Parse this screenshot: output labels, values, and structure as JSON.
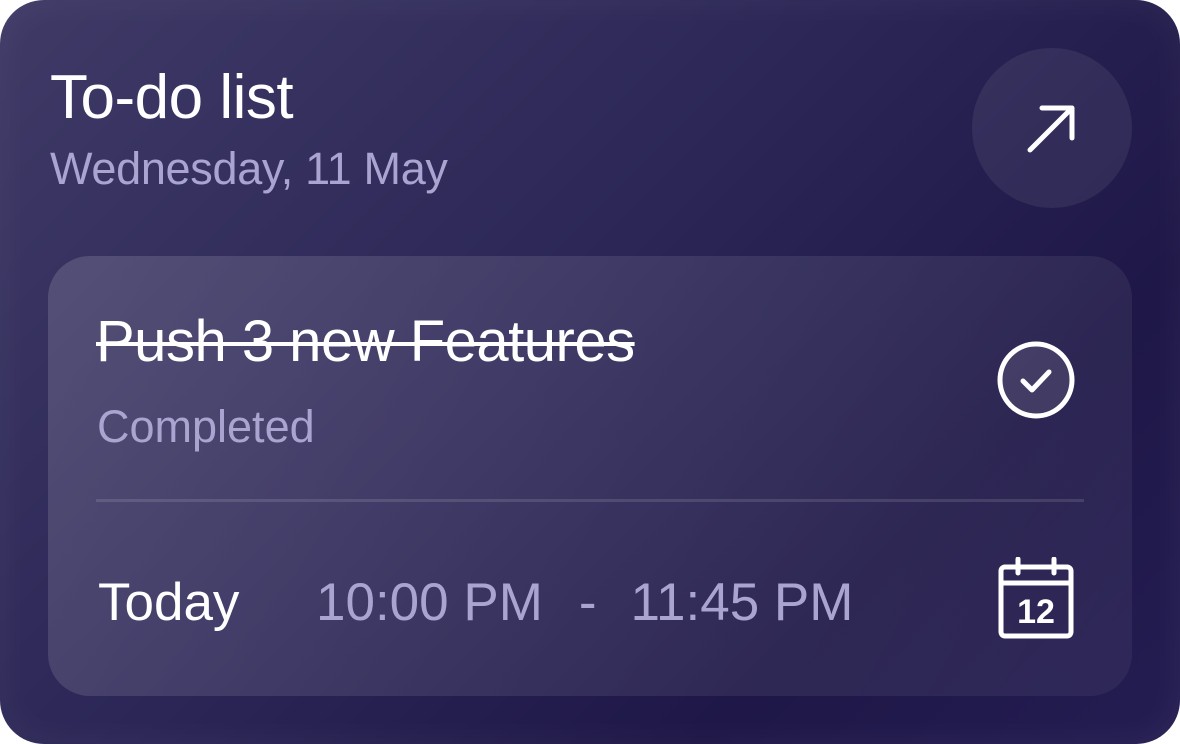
{
  "widget": {
    "title": "To-do list",
    "date": "Wednesday, 11 May",
    "expand_icon": "arrow-up-right-icon"
  },
  "task": {
    "title": "Push 3 new Features",
    "status": "Completed",
    "status_icon": "check-circle-icon",
    "day": "Today",
    "start_time": "10:00 PM",
    "separator": "-",
    "end_time": "11:45 PM",
    "calendar_icon": "calendar-icon",
    "calendar_day": "12"
  },
  "colors": {
    "background_dark": "#1e1747",
    "background_light": "#3f3a66",
    "text_primary": "#ffffff",
    "text_secondary": "#aaa4d1"
  }
}
